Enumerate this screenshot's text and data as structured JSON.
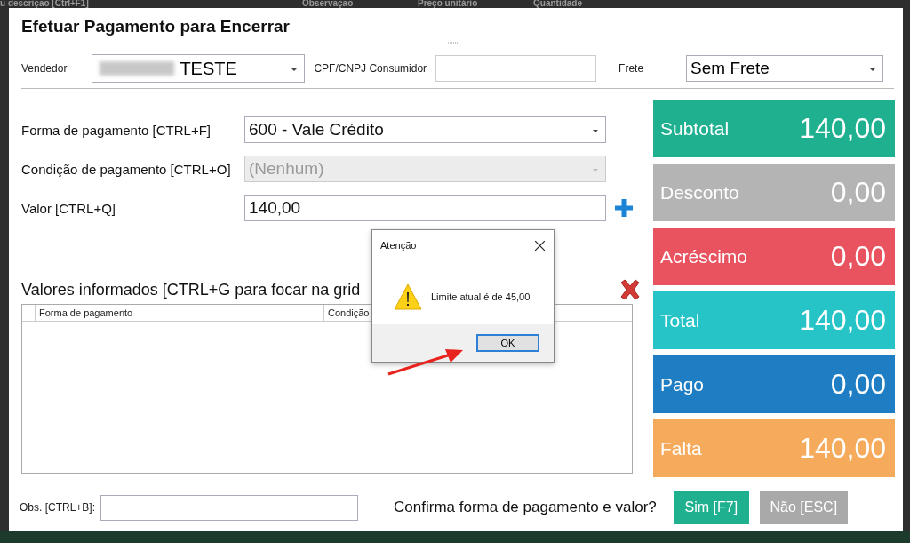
{
  "background_header": [
    "u descrição [Ctrl+F1]",
    "Observação",
    "Preço unitário",
    "Quantidade"
  ],
  "window": {
    "title": "Efetuar Pagamento para Encerrar"
  },
  "top_fields": {
    "seller": {
      "label": "Vendedor",
      "value": "TESTE",
      "redacted": true
    },
    "consumer_id": {
      "label": "CPF/CNPJ Consumidor"
    },
    "freight": {
      "label": "Frete",
      "value": "Sem Frete"
    }
  },
  "payment_form": [
    {
      "label": "Forma de pagamento [CTRL+F]",
      "kind": "combo",
      "value": "600 - Vale Crédito",
      "disabled": false
    },
    {
      "label": "Condição de pagamento [CTRL+O]",
      "kind": "combo",
      "value": "(Nenhum)",
      "disabled": true
    },
    {
      "label": "Valor [CTRL+Q]",
      "kind": "input",
      "value": "140,00",
      "disabled": false
    }
  ],
  "grid": {
    "title": "Valores informados [CTRL+G para focar na grid",
    "columns": [
      "Forma de pagamento",
      "Condição"
    ]
  },
  "totals": [
    {
      "label": "Subtotal",
      "value": "140,00",
      "color": "#1fb08f"
    },
    {
      "label": "Desconto",
      "value": "0,00",
      "color": "#b4b4b4"
    },
    {
      "label": "Acréscimo",
      "value": "0,00",
      "color": "#e9525f"
    },
    {
      "label": "Total",
      "value": "140,00",
      "color": "#26c3c7"
    },
    {
      "label": "Pago",
      "value": "0,00",
      "color": "#1f7ec3"
    },
    {
      "label": "Falta",
      "value": "140,00",
      "color": "#f6aa5c"
    }
  ],
  "footer": {
    "obs_label": "Obs. [CTRL+B]:",
    "question": "Confirma forma de pagamento e valor?",
    "buttons": [
      {
        "label": "Sim [F7]",
        "disabled": false
      },
      {
        "label": "Não [ESC]",
        "disabled": true
      }
    ]
  },
  "alert": {
    "title": "Atenção",
    "message": "Limite atual é de 45,00",
    "button": "OK"
  }
}
